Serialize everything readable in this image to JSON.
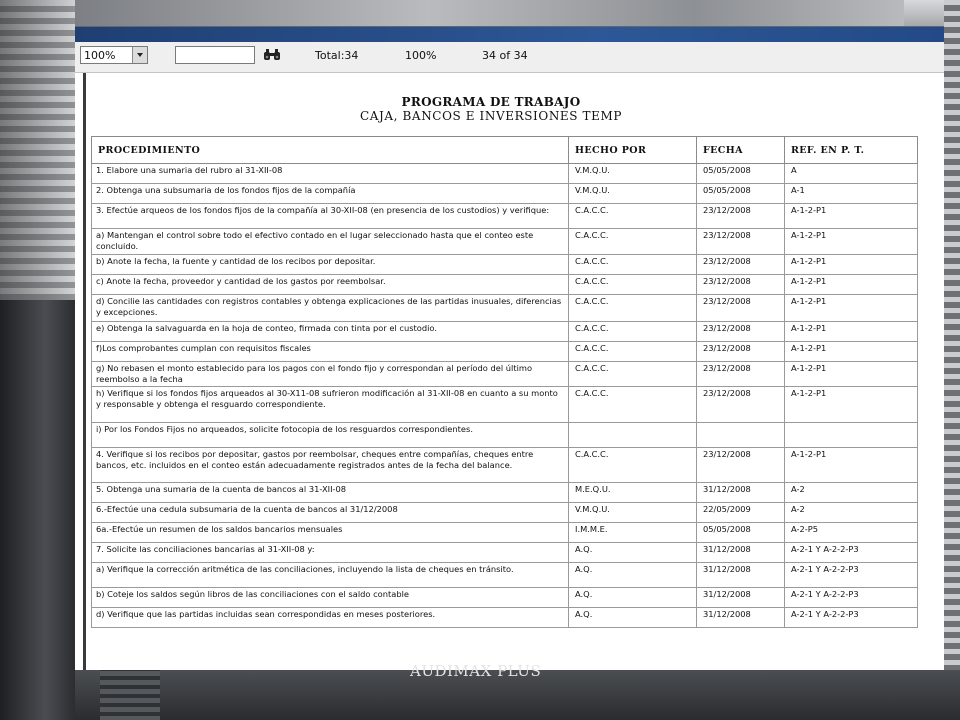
{
  "watermark": "AUDIMAX PLUS",
  "toolbar": {
    "zoom_value": "100%",
    "search_value": "",
    "total_label": "Total:34",
    "zoom_percent": "100%",
    "page_position": "34 of 34"
  },
  "report": {
    "title": "PROGRAMA DE TRABAJO",
    "subtitle": "CAJA, BANCOS E INVERSIONES TEMP",
    "columns": [
      "PROCEDIMIENTO",
      "HECHO POR",
      "FECHA",
      "REF. EN P. T."
    ],
    "rows": [
      [
        "1. Elabore una sumaria del rubro al 31-XII-08",
        "V.M.Q.U.",
        "05/05/2008",
        "A"
      ],
      [
        "2. Obtenga una subsumaria de los fondos fijos de la compañía",
        "V.M.Q.U.",
        "05/05/2008",
        "A-1"
      ],
      [
        "3. Efectúe arqueos de los fondos fijos de la compañía al 30-XII-08 (en presencia de los custodios) y verifique:",
        "C.A.C.C.",
        "23/12/2008",
        "A-1-2-P1"
      ],
      [
        "a) Mantengan el control sobre todo el efectivo contado en el lugar seleccionado hasta que el conteo este concluido.",
        "C.A.C.C.",
        "23/12/2008",
        "A-1-2-P1"
      ],
      [
        "b) Anote la fecha, la fuente y cantidad de los recibos por depositar.",
        "C.A.C.C.",
        "23/12/2008",
        "A-1-2-P1"
      ],
      [
        "c) Anote la fecha, proveedor y cantidad de los gastos por reembolsar.",
        "C.A.C.C.",
        "23/12/2008",
        "A-1-2-P1"
      ],
      [
        "d) Concilie las cantidades con registros contables y obtenga explicaciones de las partidas inusuales, diferencias y excepciones.",
        "C.A.C.C.",
        "23/12/2008",
        "A-1-2-P1"
      ],
      [
        "e) Obtenga la salvaguarda en la hoja de conteo, firmada con tinta por el custodio.",
        "C.A.C.C.",
        "23/12/2008",
        "A-1-2-P1"
      ],
      [
        "f)Los comprobantes cumplan con requisitos fiscales",
        "C.A.C.C.",
        "23/12/2008",
        "A-1-2-P1"
      ],
      [
        "g) No rebasen el monto establecido para los pagos con el fondo fijo y correspondan al período del último reembolso a la fecha",
        "C.A.C.C.",
        "23/12/2008",
        "A-1-2-P1"
      ],
      [
        "h) Verifique si los fondos fijos arqueados al 30-X11-08 sufrieron modificación al 31-XII-08 en cuanto a su monto y responsable y obtenga el resguardo correspondiente.",
        "C.A.C.C.",
        "23/12/2008",
        "A-1-2-P1"
      ],
      [
        "i) Por los Fondos Fijos no arqueados, solicite fotocopia de los resguardos correspondientes.",
        "",
        "",
        ""
      ],
      [
        "4. Verifique si los recibos por depositar, gastos por reembolsar, cheques entre compañías, cheques entre bancos, etc. incluidos en el conteo están adecuadamente registrados antes de la fecha del balance.",
        "C.A.C.C.",
        "23/12/2008",
        "A-1-2-P1"
      ],
      [
        "5. Obtenga una sumaria de la cuenta de bancos al 31-XII-08",
        "M.E.Q.U.",
        "31/12/2008",
        "A-2"
      ],
      [
        "6.-Efectúe una cedula subsumaria de la cuenta de bancos al 31/12/2008",
        "V.M.Q.U.",
        "22/05/2009",
        "A-2"
      ],
      [
        "6a.-Efectúe un resumen de los saldos bancarios mensuales",
        "I.M.M.E.",
        "05/05/2008",
        "A-2-P5"
      ],
      [
        "7. Solicite las conciliaciones bancarias al 31-XII-08 y:",
        "A.Q.",
        "31/12/2008",
        "A-2-1 Y A-2-2-P3"
      ],
      [
        "a) Verifique la corrección aritmética de las conciliaciones, incluyendo la lista de cheques en tránsito.",
        "A.Q.",
        "31/12/2008",
        "A-2-1 Y A-2-2-P3"
      ],
      [
        "b) Coteje los saldos según libros de las conciliaciones con el saldo contable",
        "A.Q.",
        "31/12/2008",
        "A-2-1 Y A-2-2-P3"
      ],
      [
        "d) Verifique que las partidas incluidas sean correspondidas en meses posteriores.",
        "A.Q.",
        "31/12/2008",
        "A-2-1 Y A-2-2-P3"
      ]
    ]
  }
}
